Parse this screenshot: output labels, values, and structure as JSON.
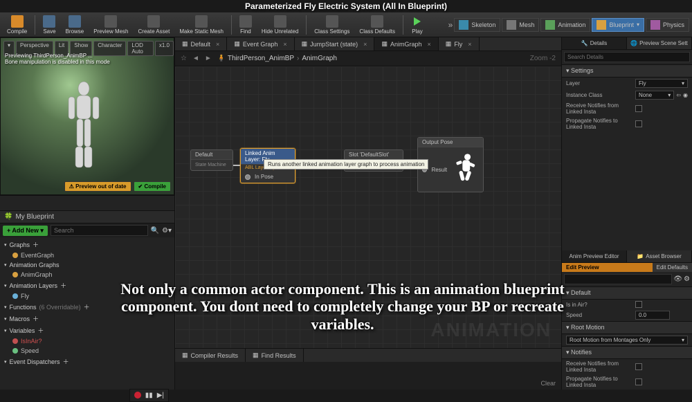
{
  "page_title": "Parameterized Fly Electric System (All In Blueprint)",
  "toolbar": {
    "compile": "Compile",
    "save": "Save",
    "browse": "Browse",
    "preview_mesh": "Preview Mesh",
    "create_asset": "Create Asset",
    "make_static_mesh": "Make Static Mesh",
    "find": "Find",
    "hide_unrelated": "Hide Unrelated",
    "class_settings": "Class Settings",
    "class_defaults": "Class Defaults",
    "play": "Play"
  },
  "modes": {
    "skeleton": "Skeleton",
    "mesh": "Mesh",
    "animation": "Animation",
    "blueprint": "Blueprint",
    "physics": "Physics"
  },
  "viewport": {
    "pills": [
      "Perspective",
      "Lit",
      "Show",
      "Character",
      "LOD Auto",
      "x1.0"
    ],
    "msg_l1": "Previewing ThirdPerson_AnimBP ...",
    "msg_l2": "Bone manipulation is disabled in this mode",
    "preview_btn": "⚠ Preview out of date",
    "compile_btn": "✔ Compile"
  },
  "my_blueprint": {
    "title": "My Blueprint",
    "add_new": "+ Add New ▾",
    "search_placeholder": "Search",
    "cats": {
      "graphs": "Graphs",
      "eventgraph": "EventGraph",
      "anim_graphs": "Animation Graphs",
      "animgraph": "AnimGraph",
      "anim_layers": "Animation Layers",
      "fly": "Fly",
      "functions": "Functions",
      "functions_note": "(6 Overridable)",
      "macros": "Macros",
      "variables": "Variables",
      "var1": "IsInAir?",
      "var2": "Speed",
      "event_dispatchers": "Event Dispatchers"
    }
  },
  "graph": {
    "tabs": [
      "Default",
      "Event Graph",
      "JumpStart (state)",
      "AnimGraph",
      "Fly"
    ],
    "active_tab": 3,
    "crumb_asset": "ThirdPerson_AnimBP",
    "crumb_graph": "AnimGraph",
    "zoom": "Zoom -2",
    "watermark": "ANIMATION",
    "node_default_title": "Default",
    "node_default_sub": "State Machine",
    "node_linked_title": "Linked Anim Layer: Fly",
    "node_linked_sub": "ABL Layer Fly",
    "node_linked_pin": "In Pose",
    "tooltip": "Runs another linked animation layer graph to process animation",
    "node_slot": "Slot 'DefaultSlot'",
    "node_output_title": "Output Pose",
    "node_output_pin": "Result"
  },
  "bottom": {
    "tabs": [
      "Compiler Results",
      "Find Results"
    ],
    "clear": "Clear"
  },
  "details": {
    "tab_details": "Details",
    "tab_preview": "Preview Scene Sett",
    "search_placeholder": "Search Details",
    "sect_settings": "Settings",
    "layer": "Layer",
    "layer_val": "Fly",
    "instance_class": "Instance Class",
    "instance_val": "None",
    "recv": "Receive Notifies from Linked Insta",
    "prop": "Propagate Notifies to Linked Insta"
  },
  "anim_preview": {
    "tab_editor": "Anim Preview Editor",
    "tab_browser": "Asset Browser",
    "edit_preview": "Edit Preview",
    "edit_defaults": "Edit Defaults",
    "sect_default": "Default",
    "is_in_air": "Is in Air?",
    "speed": "Speed",
    "speed_val": "0.0",
    "sect_root": "Root Motion",
    "root_mode_val": "Root Motion from Montages Only",
    "sect_notifies": "Notifies",
    "recv": "Receive Notifies from Linked Insta",
    "prop": "Propagate Notifies to Linked Insta"
  },
  "hero_text": "Not only a common actor component. This is an animation blueprint component. You dont need to completely change your BP or recreate variables."
}
